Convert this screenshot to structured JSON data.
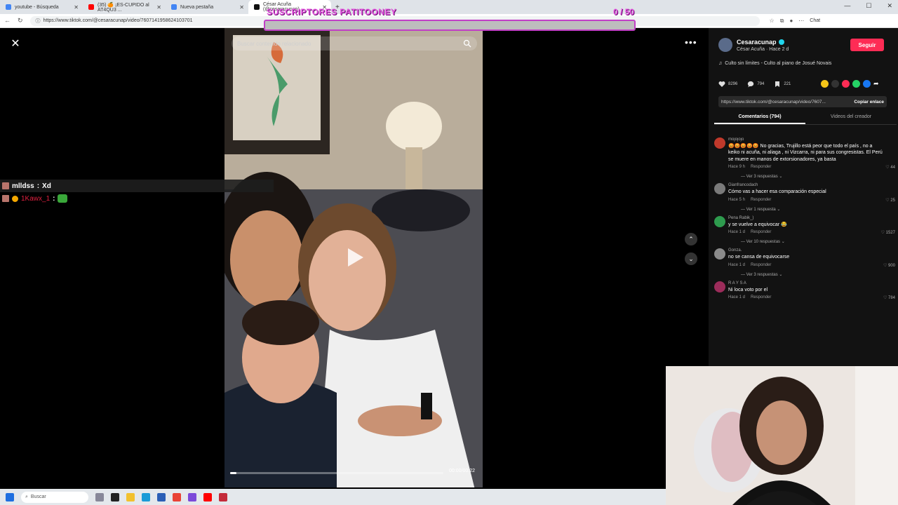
{
  "browser": {
    "tabs": [
      {
        "label": "youtube - Búsqueda",
        "color": "#4285f4"
      },
      {
        "label": "(35) 🍊 ¡ES-CUPIDO al AT4QU3 ...",
        "color": "#ff0000"
      },
      {
        "label": "Nueva pestaña",
        "color": "#4285f4"
      },
      {
        "label": "César Acuña (@cesaracunap)",
        "color": "#111111"
      }
    ],
    "url": "https://www.tiktok.com/@cesaracunap/video/7607141958624103701",
    "chat_button": "Chat"
  },
  "overlay": {
    "title": "SUSCRIPTORES PATITOONEY",
    "count": "0 / 50",
    "progress": 0
  },
  "video": {
    "search_placeholder": "Buscar contenido relacionado",
    "timecode": "00:00/00:22",
    "progress": 0.03
  },
  "chat": [
    {
      "user": "mlldss",
      "message": "Xd"
    },
    {
      "user": "1Kawx_1",
      "message": ""
    }
  ],
  "panel": {
    "author": "Cesaracunap",
    "author_sub": "César Acuña · Hace 2 d",
    "follow": "Seguir",
    "music": "Culto sin límites - Culto al piano de Josué Novais",
    "likes": "8296",
    "comments_count": "794",
    "saves": "221",
    "link": "https://www.tiktok.com/@cesaracunap/video/7607...",
    "copy_link": "Copiar enlace",
    "tab_comments": "Comentarios (794)",
    "tab_videos": "Videos del creador",
    "comments": [
      {
        "user": "mojojojo",
        "text": "😡😡😡😡😡 No gracias, Trujillo está peor que todo el país , no a keiko ni acuña, ni aliaga , ni Vizcarra, ni para sus congresistas. El Perú se muere en manos de extorsionadores, ya basta",
        "time": "Hace 9 h",
        "reply": "Responder",
        "likes": "44",
        "more": "Ver 3 respuestas",
        "color": "#c0392b"
      },
      {
        "user": "Gianfrancodach",
        "text": "Cómo vas a hacer esa comparación especial",
        "time": "Hace 5 h",
        "reply": "Responder",
        "likes": "25",
        "more": "Ver 1 respuesta",
        "color": "#7a7a7a"
      },
      {
        "user": "Pena Rabik_)",
        "text": "y se vuelve a equivocar 😂",
        "time": "Hace 1 d",
        "reply": "Responder",
        "likes": "1527",
        "more": "Ver 10 respuestas",
        "color": "#2e9b4e"
      },
      {
        "user": "Gonza.",
        "text": "no se cansa de equivocarse",
        "time": "Hace 1 d",
        "reply": "Responder",
        "likes": "900",
        "more": "Ver 3 respuestas",
        "color": "#8a8a8a"
      },
      {
        "user": "R A Y S A",
        "text": "Ni loca voto por el",
        "time": "Hace 1 d",
        "reply": "Responder",
        "likes": "784",
        "more": "",
        "color": "#9b2c5a"
      }
    ]
  },
  "taskbar": {
    "search": "Buscar"
  }
}
